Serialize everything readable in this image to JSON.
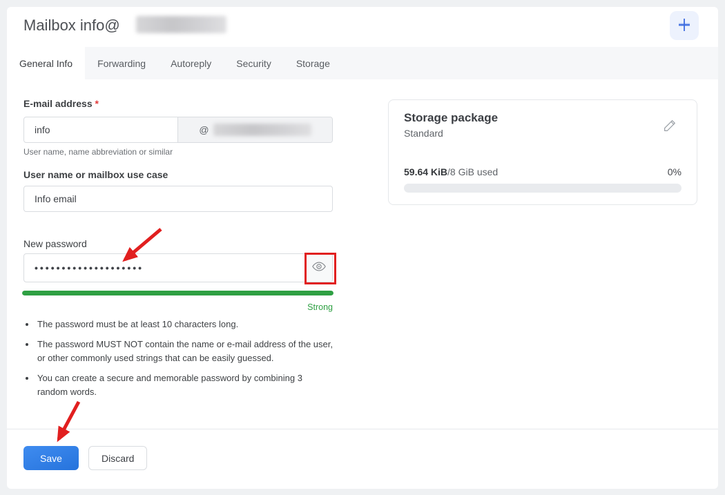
{
  "header": {
    "title": "Mailbox info@"
  },
  "tabs": [
    {
      "label": "General Info",
      "active": true
    },
    {
      "label": "Forwarding",
      "active": false
    },
    {
      "label": "Autoreply",
      "active": false
    },
    {
      "label": "Security",
      "active": false
    },
    {
      "label": "Storage",
      "active": false
    }
  ],
  "form": {
    "email": {
      "label": "E-mail address",
      "required_mark": "*",
      "value": "info",
      "at_sign": "@",
      "helper": "User name, name abbreviation or similar"
    },
    "usecase": {
      "label": "User name or mailbox use case",
      "value": "Info email"
    },
    "password": {
      "label": "New password",
      "masked_value": "••••••••••••••••••••",
      "strength_label": "Strong",
      "strength_percent": 100
    },
    "rules": [
      "The password must be at least 10 characters long.",
      "The password MUST NOT contain the name or e-mail address of the user, or other commonly used strings that can be easily guessed.",
      "You can create a secure and memorable password by combining 3 random words."
    ]
  },
  "footer": {
    "save_label": "Save",
    "discard_label": "Discard"
  },
  "storage_card": {
    "title": "Storage package",
    "package_name": "Standard",
    "used_value": "59.64 KiB",
    "used_suffix": "/8 GiB used",
    "percent_label": "0%",
    "progress_percent": 0
  },
  "icons": {
    "add": "plus-icon",
    "password_toggle": "eye-icon",
    "storage_edit": "pencil-icon"
  },
  "colors": {
    "accent_blue": "#2c7de3",
    "success_green": "#2fa043",
    "annotation_red": "#e11f1f",
    "page_background": "#eff1f3"
  }
}
